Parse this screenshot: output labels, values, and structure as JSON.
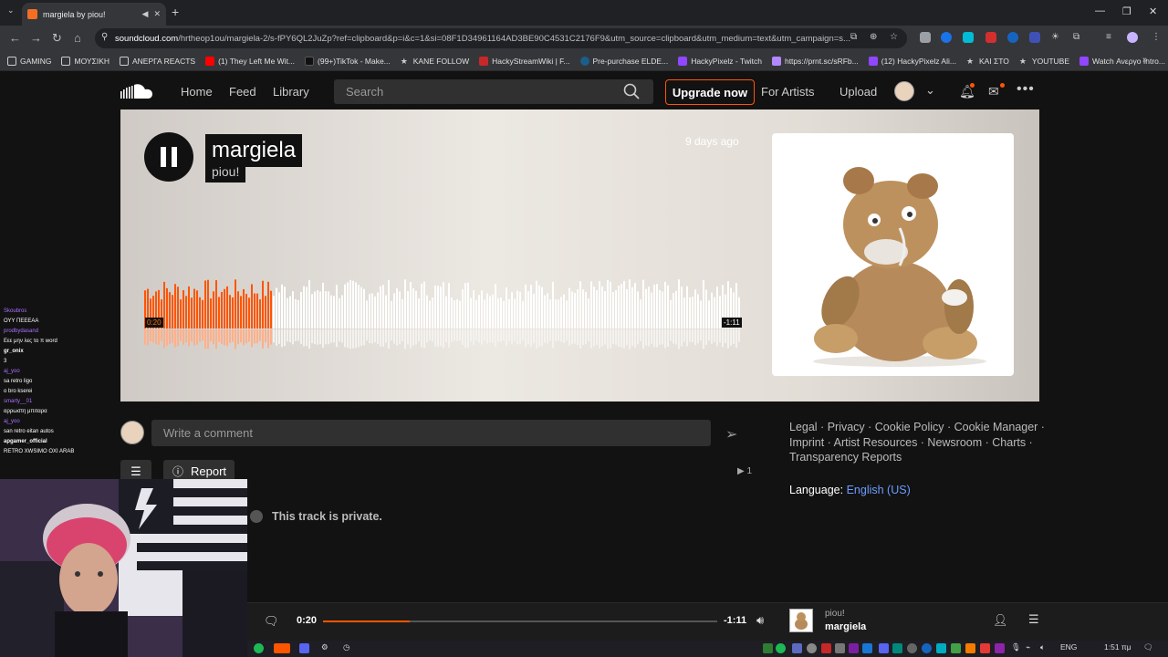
{
  "browser": {
    "tab_title": "margiela by piou!",
    "url_host": "soundcloud.com",
    "url_rest": "/hrtheop1ou/margiela-2/s-fPY6QL2JuZp?ref=clipboard&p=i&c=1&si=08F1D34961164AD3BE90C4531C2176F9&utm_source=clipboard&utm_medium=text&utm_campaign=s...",
    "bookmarks": [
      "GAMING",
      "ΜΟΥΣΙΚΗ",
      "ΑΝΕΡΓΑ REACTS",
      "(1) They Left Me Wit...",
      "(99+)TikTok - Make...",
      "KANE FOLLOW",
      "HackyStreamWiki | F...",
      "Pre-purchase ELDE...",
      "HackyPixelz - Twitch",
      "https://prnt.sc/sRFb...",
      "(12) HackyPixelz Ali...",
      "ΚΑΙ ΣΤΟ",
      "YOUTUBE",
      "Watch Ανεργο Intro..."
    ]
  },
  "header": {
    "nav": [
      "Home",
      "Feed",
      "Library"
    ],
    "search_placeholder": "Search",
    "upgrade": "Upgrade now",
    "for_artists": "For Artists",
    "upload": "Upload"
  },
  "track": {
    "title": "margiela",
    "artist": "piou!",
    "posted": "9 days ago",
    "elapsed": "0:20",
    "remaining": "-1:11",
    "progress_fraction": 0.22
  },
  "comment_placeholder": "Write a comment",
  "report_label": "Report",
  "plays_count": "1",
  "private_text": "This track is private.",
  "footer_links": "Legal · Privacy · Cookie Policy · Cookie Manager · Imprint · Artist Resources · Newsroom · Charts · Transparency Reports",
  "language_label": "Language:",
  "language_value": "English (US)",
  "chat": [
    {
      "name": "Skoubros",
      "msg": "ΟΥΥ ΠΕΕΕΑΑ"
    },
    {
      "name": "prodbydasand",
      "msg": "Εεε μην λες το π word"
    },
    {
      "name": "gr_onix",
      "msg": "3"
    },
    {
      "name": "aj_yoo",
      "msg": "sa retro ligo"
    },
    {
      "name": "",
      "msg": "o bro kserei"
    },
    {
      "name": "smarty__01",
      "msg": "αρρωστη μπιταρα"
    },
    {
      "name": "aj_yoo",
      "msg": "san retro eitan autos"
    },
    {
      "name": "apgamer_official",
      "msg": "RETRO XWSIMO OXI ARAB"
    }
  ],
  "player": {
    "elapsed": "0:20",
    "remaining": "-1:11",
    "artist": "piou!",
    "title": "margiela"
  },
  "taskbar": {
    "lang": "ENG",
    "time": "1:51 πμ"
  }
}
